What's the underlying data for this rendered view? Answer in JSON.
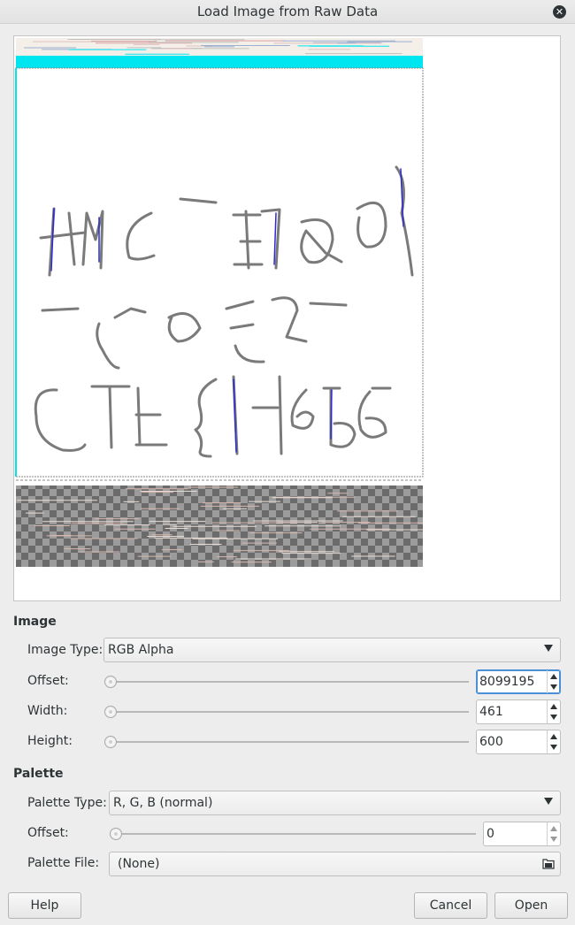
{
  "window": {
    "title": "Load Image from Raw Data",
    "close_icon": "close-icon"
  },
  "preview": {
    "description_icon": "raw-image-preview"
  },
  "image_section": {
    "heading": "Image",
    "image_type_label": "Image Type:",
    "image_type_value": "RGB Alpha",
    "offset_label": "Offset:",
    "offset_value": "8099195",
    "width_label": "Width:",
    "width_value": "461",
    "height_label": "Height:",
    "height_value": "600"
  },
  "palette_section": {
    "heading": "Palette",
    "palette_type_label": "Palette Type:",
    "palette_type_value": "R, G, B (normal)",
    "offset_label": "Offset:",
    "offset_value": "0",
    "palette_file_label": "Palette File:",
    "palette_file_value": "(None)"
  },
  "buttons": {
    "help": "Help",
    "cancel": "Cancel",
    "open": "Open"
  },
  "colors": {
    "accent": "#4a90d9",
    "background": "#ededed",
    "preview_cyan": "#00e6f0"
  }
}
